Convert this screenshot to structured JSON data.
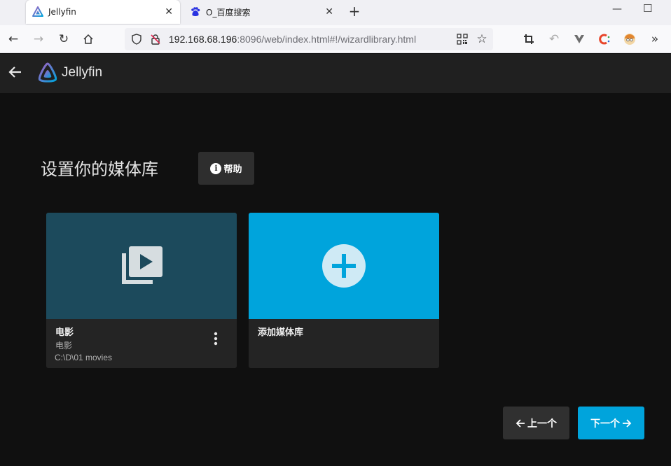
{
  "browser": {
    "tabs": [
      {
        "title": "Jellyfin",
        "active": true
      },
      {
        "title": "O_百度搜索",
        "active": false
      }
    ],
    "new_tab": "+",
    "url_host": "192.168.68.196",
    "url_rest": ":8096/web/index.html#!/wizardlibrary.html"
  },
  "app": {
    "brand": "Jellyfin"
  },
  "page": {
    "title": "设置你的媒体库",
    "help_label": "帮助",
    "help_icon": "i"
  },
  "libraries": [
    {
      "name": "电影",
      "type": "电影",
      "path": "C:\\D\\01 movies",
      "icon": "video-library-icon",
      "color": "#1c4a5c"
    }
  ],
  "add_card": {
    "label": "添加媒体库",
    "icon": "add-circle-icon",
    "color": "#00a4dc"
  },
  "wizard": {
    "prev_label": "上一个",
    "next_label": "下一个"
  },
  "colors": {
    "accent": "#00a4dc",
    "background": "#101010",
    "header": "#202020"
  }
}
